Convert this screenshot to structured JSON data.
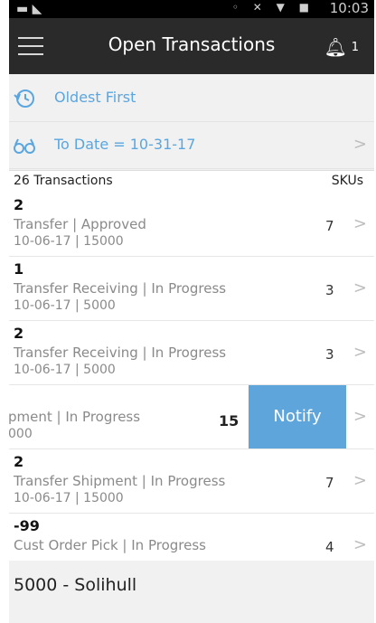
{
  "status": {
    "time": "10:03"
  },
  "header": {
    "title": "Open Transactions",
    "notification_count": "1"
  },
  "sort": {
    "label": "Oldest First"
  },
  "filter": {
    "label": "To Date = 10-31-17"
  },
  "list_header": {
    "count_label": "26 Transactions",
    "sku_column": "SKUs"
  },
  "transactions": [
    {
      "id": "2",
      "type": "Transfer | Approved",
      "meta": "10-06-17 | 15000",
      "skus": "7"
    },
    {
      "id": "1",
      "type": "Transfer Receiving | In Progress",
      "meta": "10-06-17 | 5000",
      "skus": "3"
    },
    {
      "id": "2",
      "type": "Transfer Receiving | In Progress",
      "meta": "10-06-17 | 5000",
      "skus": "3"
    },
    {
      "id": "",
      "type": "pment | In Progress",
      "meta": "000",
      "skus": "15",
      "action": "Notify"
    },
    {
      "id": "2",
      "type": "Transfer Shipment | In Progress",
      "meta": "10-06-17 | 15000",
      "skus": "7"
    },
    {
      "id": "-99",
      "type": "Cust Order Pick | In Progress",
      "meta": "",
      "skus": "4"
    }
  ],
  "footer": {
    "store": "5000 - Solihull"
  },
  "colors": {
    "accent": "#5aa6e0",
    "topbar": "#2a2a2a",
    "notify": "#5ea5dc"
  }
}
